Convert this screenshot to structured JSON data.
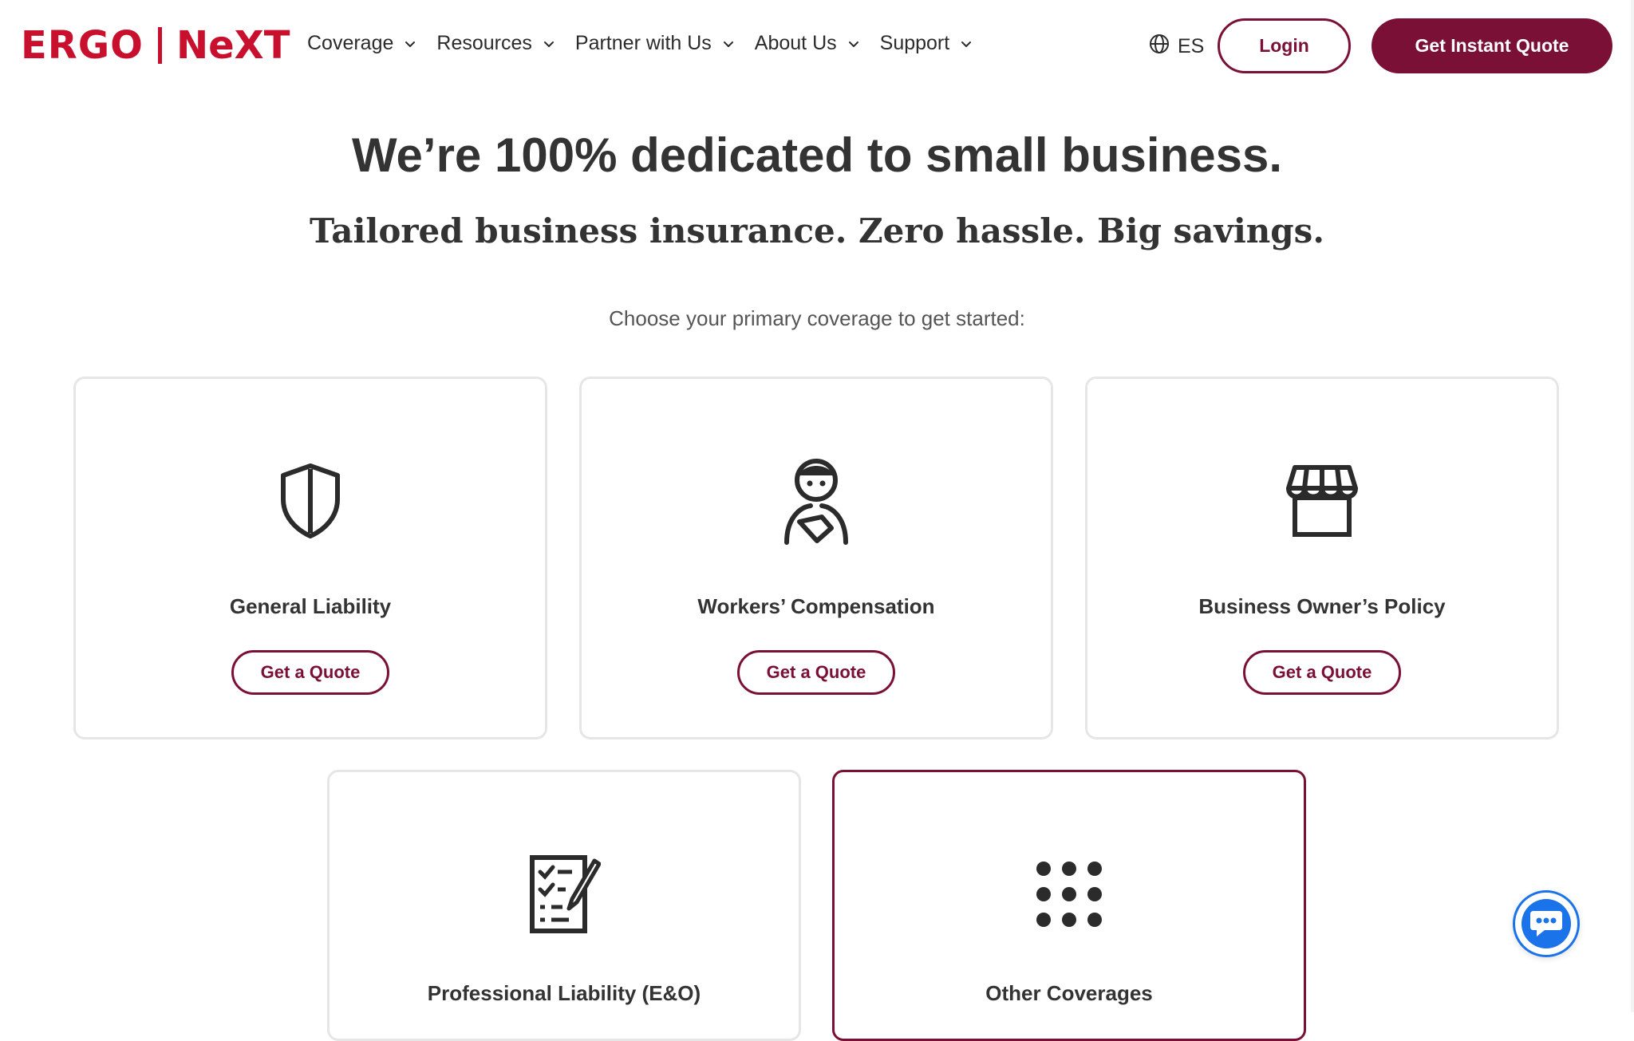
{
  "brand": {
    "part1": "ERGO",
    "part2": "NeXT",
    "color": "#c8102e"
  },
  "nav": {
    "items": [
      {
        "label": "Coverage"
      },
      {
        "label": "Resources"
      },
      {
        "label": "Partner with Us"
      },
      {
        "label": "About Us"
      },
      {
        "label": "Support"
      }
    ],
    "chevron_icon": "chevron-down-icon"
  },
  "header": {
    "language_label": "ES",
    "language_icon": "globe-icon",
    "login_label": "Login",
    "quote_label": "Get Instant Quote",
    "accent_color": "#7a1035"
  },
  "hero": {
    "title": "We’re 100% dedicated to small business.",
    "subtitle": "Tailored business insurance. Zero hassle. Big savings.",
    "prompt": "Choose your primary coverage to get started:"
  },
  "cards": [
    {
      "label": "General Liability",
      "button": "Get a Quote",
      "icon": "shield-icon"
    },
    {
      "label": "Workers’ Compensation",
      "button": "Get a Quote",
      "icon": "worker-icon"
    },
    {
      "label": "Business Owner’s Policy",
      "button": "Get a Quote",
      "icon": "storefront-icon"
    },
    {
      "label": "Professional Liability (E&O)",
      "icon": "checklist-icon"
    },
    {
      "label": "Other Coverages",
      "icon": "grid-dots-icon",
      "selected": true
    }
  ],
  "chat": {
    "icon": "chat-bubble-icon",
    "color": "#1a73e8"
  }
}
